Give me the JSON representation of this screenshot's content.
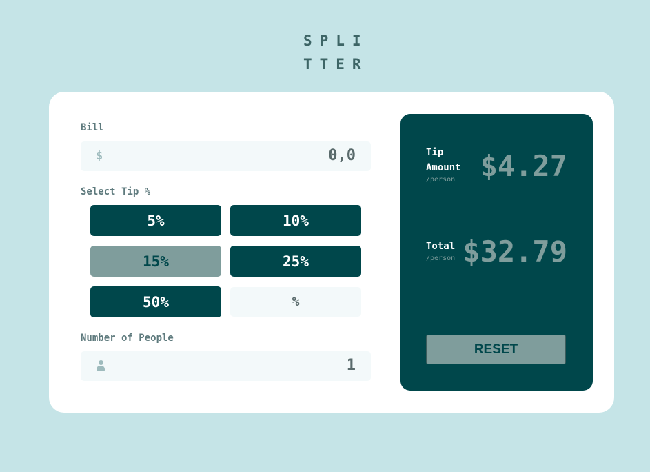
{
  "logo": {
    "line1": "SPLI",
    "line2": "TTER"
  },
  "bill": {
    "label": "Bill",
    "currency_symbol": "$",
    "value": "0,0"
  },
  "tip": {
    "label": "Select Tip %",
    "options": [
      "5%",
      "10%",
      "15%",
      "25%",
      "50%"
    ],
    "selected": "15%",
    "custom_placeholder": "%"
  },
  "people": {
    "label": "Number of People",
    "value": "1",
    "icon": "person-icon"
  },
  "results": {
    "tip_label_line1": "Tip",
    "tip_label_line2": "Amount",
    "tip_sub": "/person",
    "tip_value": "$4.27",
    "total_label": "Total",
    "total_sub": "/person",
    "total_value": "$32.79",
    "reset_label": "RESET"
  },
  "colors": {
    "background": "#c5e4e7",
    "accent_dark": "#00474b",
    "selected": "#7f9d9c"
  }
}
